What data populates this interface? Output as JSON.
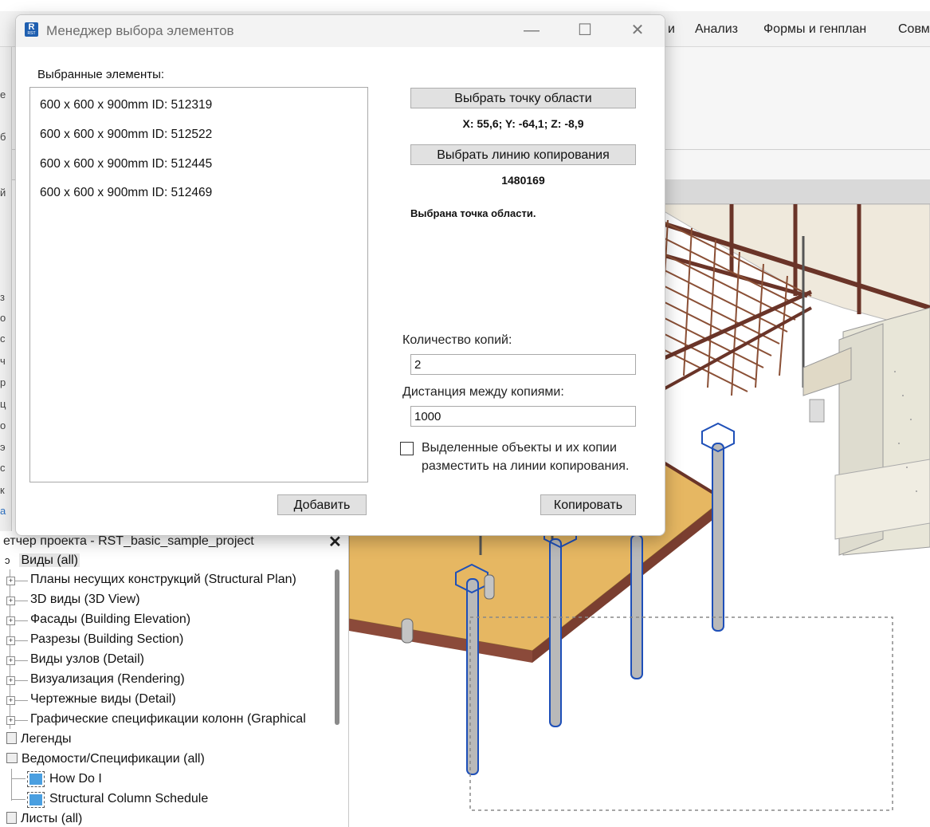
{
  "ribbon": {
    "tabs": [
      "и",
      "Анализ",
      "Формы и генплан",
      "Совм"
    ]
  },
  "left_edge_chars": [
    "е",
    "б",
    "й",
    "з",
    "о",
    "с",
    "ч",
    "р",
    "ц",
    "о",
    "э",
    "с",
    "к",
    "а"
  ],
  "project_browser": {
    "title": "етчер проекта - RST_basic_sample_project",
    "close": "✕",
    "items": [
      {
        "label": "Виды (all)",
        "level": 0
      },
      {
        "label": "Планы несущих конструкций (Structural Plan)",
        "level": 1
      },
      {
        "label": "3D виды (3D View)",
        "level": 1
      },
      {
        "label": "Фасады (Building Elevation)",
        "level": 1
      },
      {
        "label": "Разрезы (Building Section)",
        "level": 1
      },
      {
        "label": "Виды узлов (Detail)",
        "level": 1
      },
      {
        "label": "Визуализация (Rendering)",
        "level": 1
      },
      {
        "label": "Чертежные виды (Detail)",
        "level": 1
      },
      {
        "label": "Графические спецификации колонн (Graphical",
        "level": 1
      },
      {
        "label": "Легенды",
        "level": 0
      },
      {
        "label": "Ведомости/Спецификации (all)",
        "level": 0
      },
      {
        "label": "How Do I",
        "level": 2
      },
      {
        "label": "Structural Column Schedule",
        "level": 2
      },
      {
        "label": "Листы (all)",
        "level": 0
      }
    ]
  },
  "dialog": {
    "icon_text": "R",
    "icon_sub": "RST",
    "title": "Менеджер выбора элементов",
    "minimize": "—",
    "maximize": "☐",
    "close": "✕",
    "selected_label": "Выбранные элементы:",
    "selected_items": [
      "600 x 600 x 900mm ID: 512319",
      "600 x 600 x 900mm ID: 512522",
      "600 x 600 x 900mm ID: 512445",
      "600 x 600 x 900mm ID: 512469"
    ],
    "pick_point_button": "Выбрать точку области",
    "point_coords": "X: 55,6; Y: -64,1; Z: -8,9",
    "pick_line_button": "Выбрать линию копирования",
    "line_id": "1480169",
    "status": "Выбрана точка области.",
    "copies_label": "Количество копий:",
    "copies_value": "2",
    "distance_label": "Дистанция между копиями:",
    "distance_value": "1000",
    "checkbox_line1": "Выделенные объекты и их копии",
    "checkbox_line2": "разместить на линии копирования.",
    "checkbox_checked": false,
    "add_button": "Добавить",
    "copy_button": "Копировать"
  }
}
